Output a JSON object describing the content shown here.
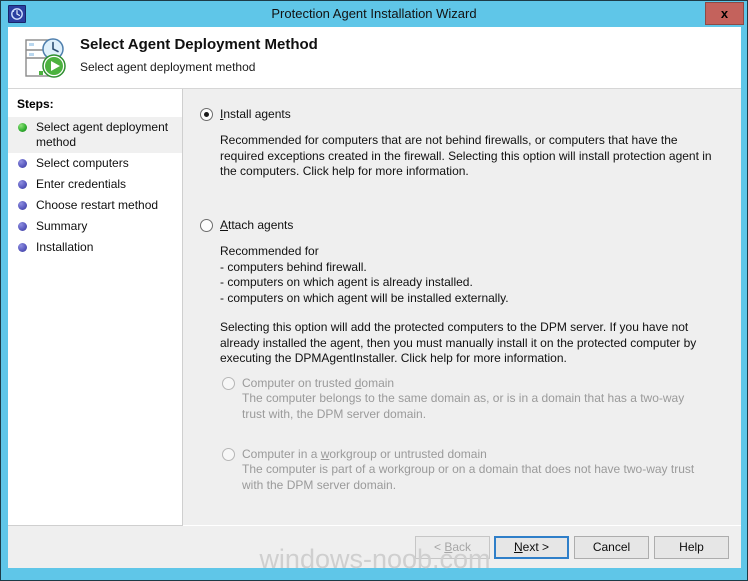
{
  "window": {
    "title": "Protection Agent Installation Wizard",
    "icon": "clock-recovery-icon",
    "close_label": "x",
    "frame_color": "#5FC6E8",
    "close_color": "#c4625c"
  },
  "header": {
    "icon": "server-clock-play-icon",
    "title": "Select Agent Deployment Method",
    "subtitle": "Select agent deployment method"
  },
  "sidebar": {
    "title": "Steps:",
    "items": [
      {
        "label": "Select agent deployment method",
        "state": "active",
        "bullet_color": "#34b233"
      },
      {
        "label": "Select computers",
        "state": "pending",
        "bullet_color": "#5b5bc0"
      },
      {
        "label": "Enter credentials",
        "state": "pending",
        "bullet_color": "#5b5bc0"
      },
      {
        "label": "Choose restart method",
        "state": "pending",
        "bullet_color": "#5b5bc0"
      },
      {
        "label": "Summary",
        "state": "pending",
        "bullet_color": "#5b5bc0"
      },
      {
        "label": "Installation",
        "state": "pending",
        "bullet_color": "#5b5bc0"
      }
    ]
  },
  "main": {
    "install": {
      "label_pre": "",
      "label_key": "I",
      "label_post": "nstall agents",
      "selected": true,
      "description": "Recommended for computers that are not behind firewalls, or computers that have the required exceptions created in the firewall. Selecting this option will install protection agent in the computers. Click help for more information."
    },
    "attach": {
      "label_pre": "",
      "label_key": "A",
      "label_post": "ttach agents",
      "selected": false,
      "description_intro": "Recommended for",
      "description_bullets": [
        "- computers behind firewall.",
        "- computers on which agent is already installed.",
        "- computers on which agent will be installed externally."
      ],
      "description_note": "Selecting this option will add the protected computers to the DPM server. If you have not already installed the agent, then you must manually install it on the protected computer by executing the DPMAgentInstaller. Click help for more information."
    },
    "trusted_domain": {
      "label_pre": "Computer on trusted ",
      "label_key": "d",
      "label_post": "omain",
      "selected": false,
      "disabled": true,
      "description": "The computer belongs to the same domain as, or is in a domain that has a two-way trust with, the DPM server domain."
    },
    "workgroup_domain": {
      "label_pre": "Computer in a ",
      "label_key": "w",
      "label_post": "orkgroup or untrusted domain",
      "selected": false,
      "disabled": true,
      "description": "The computer is part of a workgroup or on a domain that does not have two-way trust with the DPM server domain."
    }
  },
  "buttons": {
    "back": {
      "pre": "< ",
      "key": "B",
      "post": "ack",
      "disabled": true
    },
    "next": {
      "pre": "",
      "key": "N",
      "post": "ext >",
      "default": true
    },
    "cancel": {
      "label": "Cancel"
    },
    "help": {
      "label": "Help"
    }
  },
  "watermark": {
    "text": "windows-noob.com"
  }
}
